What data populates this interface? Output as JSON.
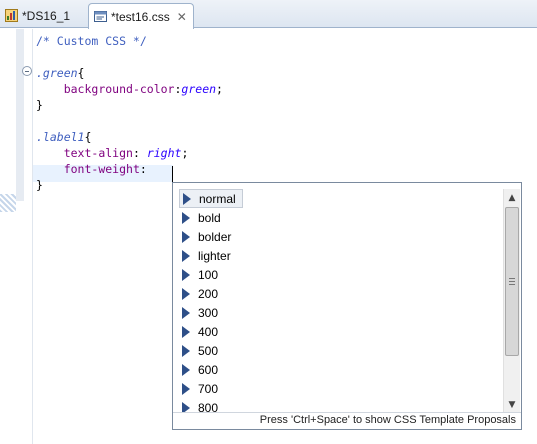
{
  "tabs": [
    {
      "label": "*DS16_1",
      "icon": "report-icon",
      "closable": false
    },
    {
      "label": "*test16.css",
      "icon": "css-file-icon",
      "closable": true,
      "close": "✕"
    }
  ],
  "code_lines": [
    {
      "tokens": [
        {
          "cls": "cmt",
          "text": "/* Custom CSS */"
        }
      ]
    },
    {
      "tokens": []
    },
    {
      "tokens": [
        {
          "cls": "sel",
          "text": ".green"
        },
        {
          "cls": "punc",
          "text": "{"
        }
      ]
    },
    {
      "tokens": [
        {
          "cls": "punc",
          "text": "    "
        },
        {
          "cls": "prop",
          "text": "background-color"
        },
        {
          "cls": "punc",
          "text": ":"
        },
        {
          "cls": "val",
          "text": "green"
        },
        {
          "cls": "punc",
          "text": ";"
        }
      ]
    },
    {
      "tokens": [
        {
          "cls": "punc",
          "text": "}"
        }
      ]
    },
    {
      "tokens": []
    },
    {
      "tokens": [
        {
          "cls": "sel",
          "text": ".label1"
        },
        {
          "cls": "punc",
          "text": "{"
        }
      ]
    },
    {
      "tokens": [
        {
          "cls": "punc",
          "text": "    "
        },
        {
          "cls": "prop",
          "text": "text-align"
        },
        {
          "cls": "punc",
          "text": ": "
        },
        {
          "cls": "val",
          "text": "right"
        },
        {
          "cls": "punc",
          "text": ";"
        }
      ]
    },
    {
      "tokens": [
        {
          "cls": "punc",
          "text": "    "
        },
        {
          "cls": "prop",
          "text": "font-weight"
        },
        {
          "cls": "punc",
          "text": ": "
        }
      ]
    },
    {
      "tokens": [
        {
          "cls": "punc",
          "text": "}"
        }
      ]
    }
  ],
  "proposals": {
    "items": [
      "normal",
      "bold",
      "bolder",
      "lighter",
      "100",
      "200",
      "300",
      "400",
      "500",
      "600",
      "700",
      "800"
    ],
    "selected_index": 0,
    "item_icon": "property-value-icon",
    "status_text": "Press 'Ctrl+Space' to show CSS Template Proposals",
    "scroll_up": "▲",
    "scroll_down": "▼"
  },
  "colors": {
    "comment": "#3f5fbf",
    "property": "#7f007f",
    "value": "#2a00ff",
    "current_line": "#e8f2fe"
  }
}
